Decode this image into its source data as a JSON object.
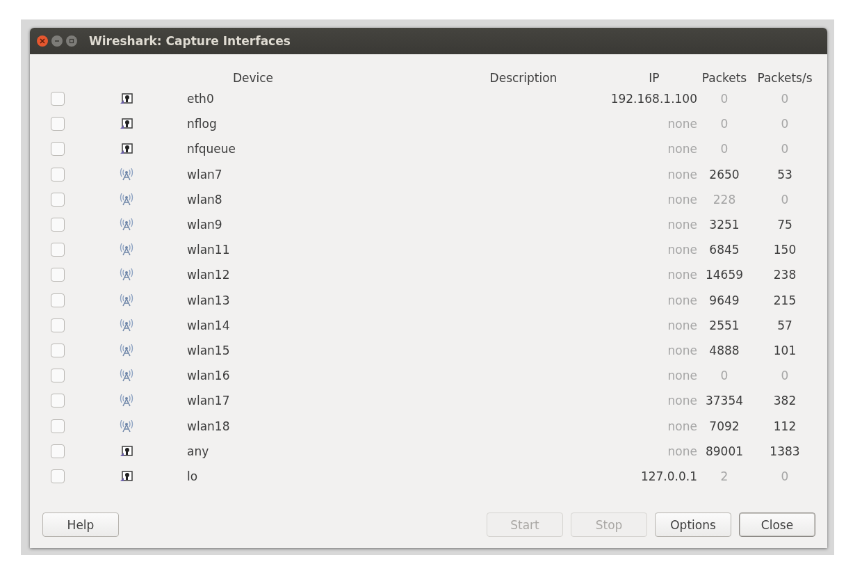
{
  "window": {
    "title": "Wireshark: Capture Interfaces"
  },
  "columns": [
    "Device",
    "Description",
    "IP",
    "Packets",
    "Packets/s"
  ],
  "rows": [
    {
      "kind": "wired",
      "checked": false,
      "device": "eth0",
      "ip": "192.168.1.100",
      "ip_dimmed": false,
      "packets": "0",
      "rate": "0",
      "active": false
    },
    {
      "kind": "wired",
      "checked": false,
      "device": "nflog",
      "ip": "none",
      "ip_dimmed": true,
      "packets": "0",
      "rate": "0",
      "active": false
    },
    {
      "kind": "wired",
      "checked": false,
      "device": "nfqueue",
      "ip": "none",
      "ip_dimmed": true,
      "packets": "0",
      "rate": "0",
      "active": false
    },
    {
      "kind": "wireless",
      "checked": false,
      "device": "wlan7",
      "ip": "none",
      "ip_dimmed": true,
      "packets": "2650",
      "rate": "53",
      "active": true
    },
    {
      "kind": "wireless",
      "checked": false,
      "device": "wlan8",
      "ip": "none",
      "ip_dimmed": true,
      "packets": "228",
      "rate": "0",
      "active": false
    },
    {
      "kind": "wireless",
      "checked": false,
      "device": "wlan9",
      "ip": "none",
      "ip_dimmed": true,
      "packets": "3251",
      "rate": "75",
      "active": true
    },
    {
      "kind": "wireless",
      "checked": false,
      "device": "wlan11",
      "ip": "none",
      "ip_dimmed": true,
      "packets": "6845",
      "rate": "150",
      "active": true
    },
    {
      "kind": "wireless",
      "checked": false,
      "device": "wlan12",
      "ip": "none",
      "ip_dimmed": true,
      "packets": "14659",
      "rate": "238",
      "active": true
    },
    {
      "kind": "wireless",
      "checked": false,
      "device": "wlan13",
      "ip": "none",
      "ip_dimmed": true,
      "packets": "9649",
      "rate": "215",
      "active": true
    },
    {
      "kind": "wireless",
      "checked": false,
      "device": "wlan14",
      "ip": "none",
      "ip_dimmed": true,
      "packets": "2551",
      "rate": "57",
      "active": true
    },
    {
      "kind": "wireless",
      "checked": false,
      "device": "wlan15",
      "ip": "none",
      "ip_dimmed": true,
      "packets": "4888",
      "rate": "101",
      "active": true
    },
    {
      "kind": "wireless",
      "checked": false,
      "device": "wlan16",
      "ip": "none",
      "ip_dimmed": true,
      "packets": "0",
      "rate": "0",
      "active": false
    },
    {
      "kind": "wireless",
      "checked": false,
      "device": "wlan17",
      "ip": "none",
      "ip_dimmed": true,
      "packets": "37354",
      "rate": "382",
      "active": true
    },
    {
      "kind": "wireless",
      "checked": false,
      "device": "wlan18",
      "ip": "none",
      "ip_dimmed": true,
      "packets": "7092",
      "rate": "112",
      "active": true
    },
    {
      "kind": "wired",
      "checked": false,
      "device": "any",
      "ip": "none",
      "ip_dimmed": true,
      "packets": "89001",
      "rate": "1383",
      "active": true
    },
    {
      "kind": "wired",
      "checked": false,
      "device": "lo",
      "ip": "127.0.0.1",
      "ip_dimmed": false,
      "packets": "2",
      "rate": "0",
      "active": false
    }
  ],
  "buttons": [
    {
      "label": "Help",
      "disabled": false,
      "default": false
    },
    {
      "label": "Start",
      "disabled": true,
      "default": false
    },
    {
      "label": "Stop",
      "disabled": true,
      "default": false
    },
    {
      "label": "Options",
      "disabled": false,
      "default": false
    },
    {
      "label": "Close",
      "disabled": false,
      "default": true
    }
  ]
}
